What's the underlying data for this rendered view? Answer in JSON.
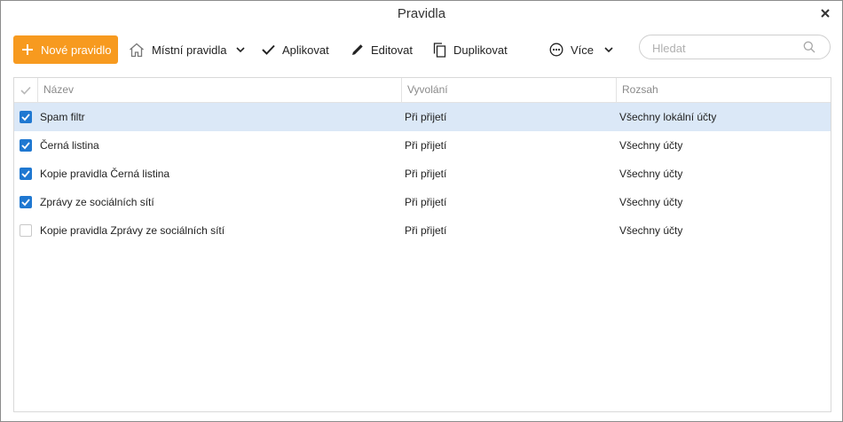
{
  "window": {
    "title": "Pravidla"
  },
  "toolbar": {
    "new_rule": "Nové pravidlo",
    "local_rules": "Místní pravidla",
    "apply": "Aplikovat",
    "edit": "Editovat",
    "duplicate": "Duplikovat",
    "more": "Více",
    "search_placeholder": "Hledat"
  },
  "table": {
    "headers": {
      "name": "Název",
      "trigger": "Vyvolání",
      "scope": "Rozsah"
    },
    "rows": [
      {
        "checked": true,
        "name": "Spam filtr",
        "trigger": "Při přijetí",
        "scope": "Všechny lokální účty",
        "selected": true
      },
      {
        "checked": true,
        "name": "Černá listina",
        "trigger": "Při přijetí",
        "scope": "Všechny účty",
        "selected": false
      },
      {
        "checked": true,
        "name": "Kopie pravidla Černá listina",
        "trigger": "Při přijetí",
        "scope": "Všechny účty",
        "selected": false
      },
      {
        "checked": true,
        "name": "Zprávy ze sociálních sítí",
        "trigger": "Při přijetí",
        "scope": "Všechny účty",
        "selected": false
      },
      {
        "checked": false,
        "name": "Kopie pravidla Zprávy ze sociálních sítí",
        "trigger": "Při přijetí",
        "scope": "Všechny účty",
        "selected": false
      }
    ]
  },
  "colors": {
    "accent": "#f79a1f",
    "checkbox": "#1f78d1",
    "selected_row": "#dbe8f7"
  }
}
